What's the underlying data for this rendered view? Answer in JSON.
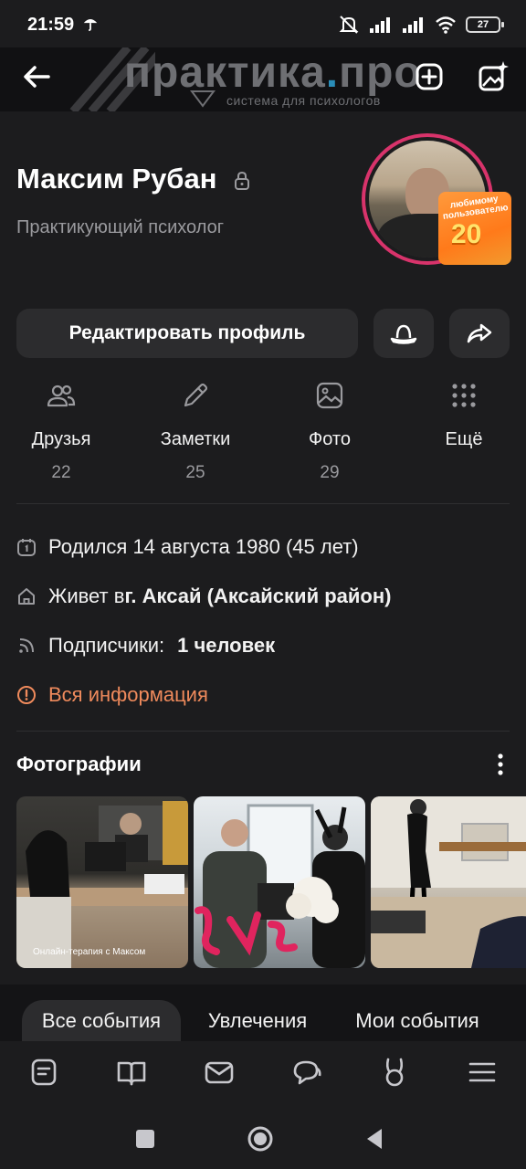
{
  "status_bar": {
    "time": "21:59",
    "battery": "27"
  },
  "cover": {
    "logo_main": "практика",
    "logo_dot": ".",
    "logo_tail": "про",
    "logo_sub": "система для психологов"
  },
  "profile": {
    "name": "Максим Рубан",
    "status": "Практикующий психолог"
  },
  "badge": {
    "text": "любимому пользователю",
    "number": "20"
  },
  "actions": {
    "edit_label": "Редактировать профиль"
  },
  "stats": [
    {
      "label": "Друзья",
      "count": "22"
    },
    {
      "label": "Заметки",
      "count": "25"
    },
    {
      "label": "Фото",
      "count": "29"
    },
    {
      "label": "Ещё",
      "count": ""
    }
  ],
  "info": {
    "birthday": "Родился 14 августа 1980 (45 лет)",
    "lives_prefix": "Живет в ",
    "lives_city": "г. Аксай (Аксайский район)",
    "followers_label": "Подписчики:",
    "followers_value": "1 человек",
    "all_info": "Вся информация"
  },
  "photos_section": {
    "title": "Фотографии",
    "photos": [
      {
        "caption": "Онлайн-терапия с Максом"
      },
      {
        "caption": ""
      },
      {
        "caption": ""
      }
    ]
  },
  "tabs": [
    {
      "label": "Все события",
      "active": true
    },
    {
      "label": "Увлечения",
      "active": false
    },
    {
      "label": "Мои события",
      "active": false
    }
  ],
  "bottom_nav": [
    "feed-icon",
    "book-icon",
    "mail-icon",
    "chat-icon",
    "bunny-icon",
    "menu-icon"
  ],
  "colors": {
    "accent": "#ef8a5c",
    "avatar_ring": "#d8336b",
    "background": "#1c1c1e",
    "card": "#2c2c2e"
  }
}
